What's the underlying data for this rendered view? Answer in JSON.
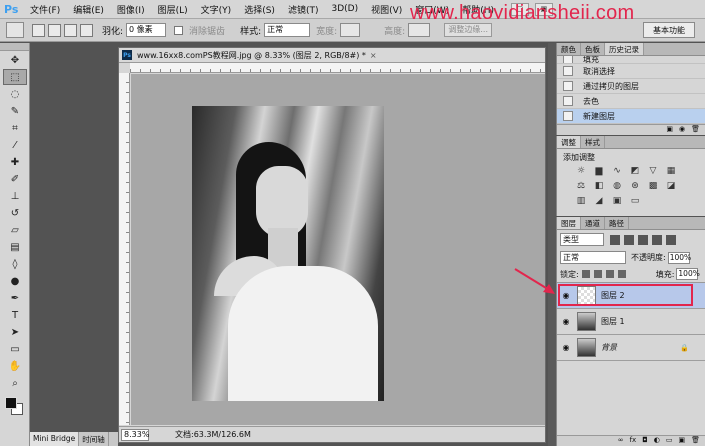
{
  "app": {
    "logo": "Ps"
  },
  "menu": [
    "文件(F)",
    "编辑(E)",
    "图像(I)",
    "图层(L)",
    "文字(Y)",
    "选择(S)",
    "滤镜(T)",
    "3D(D)",
    "视图(V)",
    "窗口(W)",
    "帮助(H)"
  ],
  "watermark": "www.haoyidiansheji.com",
  "options": {
    "feather_label": "羽化:",
    "feather_value": "0 像素",
    "antialias_label": "消除锯齿",
    "style_label": "样式:",
    "style_value": "正常",
    "width_label": "宽度:",
    "height_label": "高度:",
    "refine_edge": "调整边缘...",
    "workspace": "基本功能"
  },
  "document": {
    "tab_title": "www.16xx8.comPS教程网.jpg @ 8.33% (图层 2, RGB/8#) *",
    "zoom": "8.33%",
    "doc_info": "文档:63.3M/126.6M"
  },
  "bottom_tabs": [
    "Mini Bridge",
    "时间轴"
  ],
  "history": {
    "tabs": [
      "颜色",
      "色板",
      "历史记录"
    ],
    "items": [
      "填充",
      "取消选择",
      "通过拷贝的图层",
      "去色",
      "新建图层"
    ],
    "selected_index": 4
  },
  "adjustments": {
    "tabs": [
      "调整",
      "样式"
    ],
    "title": "添加调整"
  },
  "layers": {
    "tabs": [
      "图层",
      "通道",
      "路径"
    ],
    "kind": "类型",
    "blend_mode": "正常",
    "opacity_label": "不透明度:",
    "opacity": "100%",
    "lock_label": "锁定:",
    "fill_label": "填充:",
    "fill": "100%",
    "items": [
      {
        "name": "图层 2",
        "selected": true
      },
      {
        "name": "图层 1",
        "selected": false
      },
      {
        "name": "背景",
        "selected": false
      }
    ]
  },
  "colors": {
    "accent": "#e2264d",
    "selection": "#b7c8ea"
  }
}
